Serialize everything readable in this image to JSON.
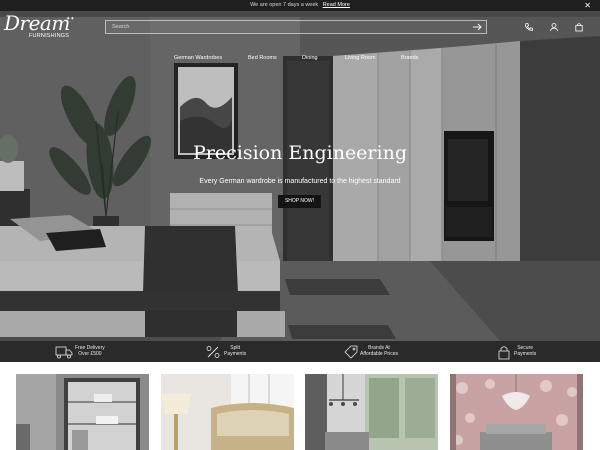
{
  "announcement": {
    "text": "We are open 7 days a week",
    "link": "Read More",
    "close_icon": "close-icon"
  },
  "brand": {
    "name_script": "Dream",
    "name_sub": "FURNISHINGS",
    "stars": "✦✦"
  },
  "search": {
    "placeholder": "Search",
    "submit_icon": "arrow-right-icon"
  },
  "header_icons": [
    "phone-icon",
    "user-icon",
    "bag-icon"
  ],
  "nav": {
    "items": [
      "German Wardrobes",
      "Bed Rooms",
      "Dining",
      "Living Room",
      "Brands"
    ]
  },
  "hero": {
    "title": "Precision Engineering",
    "subtitle": "Every German wardrobe is manufactured to the highest standard",
    "cta": "SHOP NOW!"
  },
  "features": [
    {
      "icon": "delivery-truck-icon",
      "line1": "Free Delivery",
      "line2": "Over £500"
    },
    {
      "icon": "percent-icon",
      "line1": "Split",
      "line2": "Payments"
    },
    {
      "icon": "price-tag-icon",
      "line1": "Brands At",
      "line2": "Affordable Prices"
    },
    {
      "icon": "lock-icon",
      "line1": "Secure",
      "line2": "Payments"
    }
  ],
  "tiles": [
    "bookcase-tile",
    "bedroom-tile",
    "dining-tile",
    "living-room-tile"
  ],
  "colors": {
    "topbar": "#1f1f1f",
    "features_bar": "#2a2a2a",
    "button": "#141414",
    "text_light": "#ffffff"
  }
}
